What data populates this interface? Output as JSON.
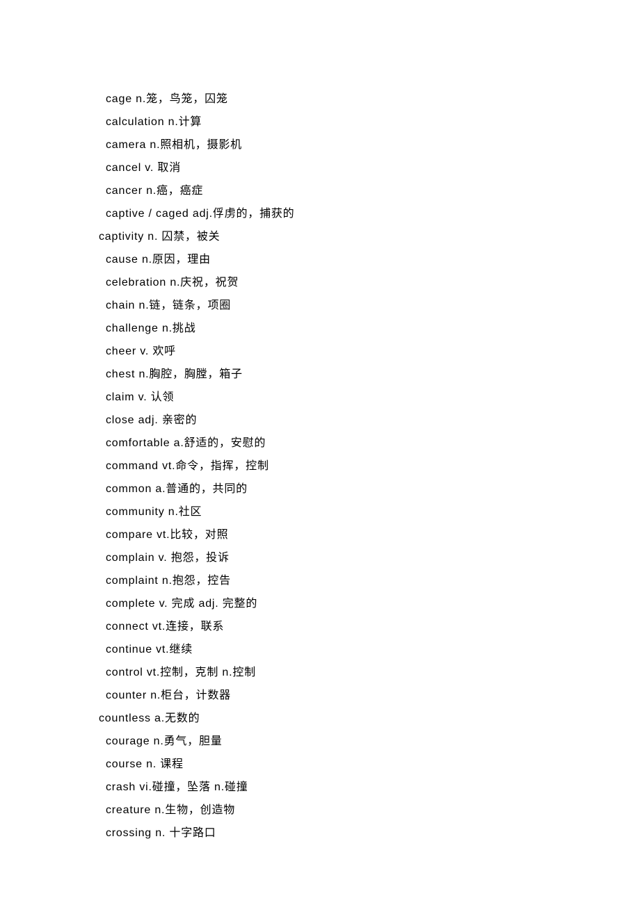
{
  "entries": [
    {
      "text": "cage n.笼，鸟笼，囚笼",
      "indent": true
    },
    {
      "text": "calculation n.计算",
      "indent": true
    },
    {
      "text": "camera n.照相机，摄影机",
      "indent": true
    },
    {
      "text": "cancel v.   取消",
      "indent": true
    },
    {
      "text": "cancer n.癌，癌症",
      "indent": true
    },
    {
      "text": "captive / caged   adj.俘虏的，捕获的",
      "indent": true
    },
    {
      "text": "captivity n. 囚禁，被关",
      "indent": false
    },
    {
      "text": "cause n.原因，理由",
      "indent": true
    },
    {
      "text": "celebration n.庆祝，祝贺",
      "indent": true
    },
    {
      "text": "chain n.链，链条，项圈",
      "indent": true
    },
    {
      "text": "challenge n.挑战",
      "indent": true
    },
    {
      "text": "cheer v.   欢呼",
      "indent": true
    },
    {
      "text": "chest n.胸腔，胸膛，箱子",
      "indent": true
    },
    {
      "text": "claim v. 认领",
      "indent": true
    },
    {
      "text": "close adj.   亲密的",
      "indent": true
    },
    {
      "text": "comfortable a.舒适的，安慰的",
      "indent": true
    },
    {
      "text": "command vt.命令，指挥，控制",
      "indent": true
    },
    {
      "text": "common a.普通的，共同的",
      "indent": true
    },
    {
      "text": "community n.社区",
      "indent": true
    },
    {
      "text": "compare vt.比较，对照",
      "indent": true
    },
    {
      "text": "complain v.   抱怨，投诉",
      "indent": true
    },
    {
      "text": "complaint n.抱怨，控告",
      "indent": true
    },
    {
      "text": "complete v. 完成  adj.   完整的",
      "indent": true
    },
    {
      "text": "connect vt.连接，联系",
      "indent": true
    },
    {
      "text": "continue vt.继续",
      "indent": true
    },
    {
      "text": "control vt.控制，克制  n.控制",
      "indent": true
    },
    {
      "text": "counter n.柜台，计数器",
      "indent": true
    },
    {
      "text": "countless a.无数的",
      "indent": false
    },
    {
      "text": "courage n.勇气，胆量",
      "indent": true
    },
    {
      "text": "course n. 课程",
      "indent": true
    },
    {
      "text": "crash vi.碰撞，坠落  n.碰撞",
      "indent": true
    },
    {
      "text": "creature n.生物，创造物",
      "indent": true
    },
    {
      "text": "crossing n. 十字路口",
      "indent": true
    }
  ]
}
